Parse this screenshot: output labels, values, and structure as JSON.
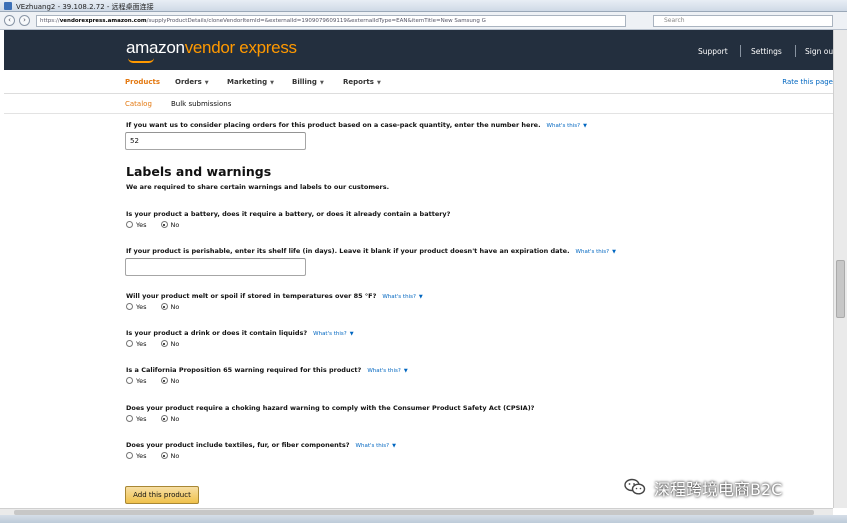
{
  "window": {
    "title": "VEzhuang2 - 39.108.2.72 - 远程桌面连接"
  },
  "browser": {
    "url_prefix": "https://",
    "url_host": "vendorexpress.amazon.com",
    "url_rest": "/supplyProductDetails/cloneVendorItemId=&externalId=1909079609119&externalIdType=EAN&itemTitle=New Samsung G",
    "search_placeholder": "Search"
  },
  "header": {
    "logo_main": "amazon",
    "logo_accent": "vendor express",
    "links": [
      "Support",
      "Settings",
      "Sign out"
    ]
  },
  "nav": {
    "items": [
      {
        "label": "Products",
        "active": true,
        "dropdown": false
      },
      {
        "label": "Orders",
        "active": false,
        "dropdown": true
      },
      {
        "label": "Marketing",
        "active": false,
        "dropdown": true
      },
      {
        "label": "Billing",
        "active": false,
        "dropdown": true
      },
      {
        "label": "Reports",
        "active": false,
        "dropdown": true
      }
    ],
    "rate_link": "Rate this page"
  },
  "subnav": {
    "items": [
      "Catalog",
      "Bulk submissions"
    ]
  },
  "form": {
    "case_pack": {
      "question": "If you want us to consider placing orders for this product based on a case-pack quantity, enter the number here.",
      "value": "52"
    },
    "whats_this": "What's this?",
    "section_title": "Labels and warnings",
    "section_subtitle": "We are required to share certain warnings and labels to our customers.",
    "yes_label": "Yes",
    "no_label": "No",
    "battery_q": "Is your product a battery, does it require a battery, or does it already contain a battery?",
    "shelf_life_q": "If your product is perishable, enter its shelf life (in days). Leave it blank if your product doesn't have an expiration date.",
    "shelf_life_value": "",
    "melt_q": "Will your product melt or spoil if stored in temperatures over 85 °F?",
    "drink_q": "Is your product a drink or does it contain liquids?",
    "prop65_q": "Is a California Proposition 65 warning required for this product?",
    "choking_q": "Does your product require a choking hazard warning to comply with the Consumer Product Safety Act (CPSIA)?",
    "textiles_q": "Does your product include textiles, fur, or fiber components?",
    "selected": "No",
    "submit_label": "Add this product"
  },
  "watermark": {
    "text": "深程跨境电商B2C"
  },
  "colors": {
    "header_bg": "#232f3e",
    "accent_orange": "#ff9900",
    "active_nav": "#e47911",
    "link_blue": "#0066c0",
    "button_yellow": "#f0c14b"
  }
}
